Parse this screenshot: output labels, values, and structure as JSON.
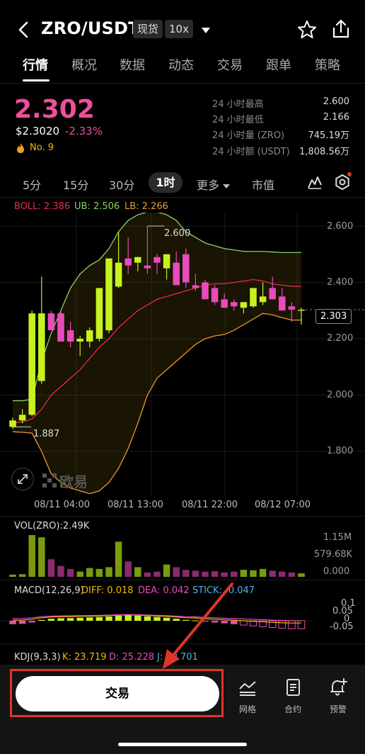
{
  "header": {
    "pair": "ZRO/USDT",
    "market_tag": "现货",
    "leverage_tag": "10x"
  },
  "tabs": [
    "行情",
    "概况",
    "数据",
    "动态",
    "交易",
    "跟单",
    "策略"
  ],
  "price": {
    "last": "2.302",
    "usd": "$2.3020",
    "change_pct": "-2.33%",
    "rank": "No. 9",
    "stats": [
      {
        "label": "24 小时最高",
        "value": "2.600"
      },
      {
        "label": "24 小时最低",
        "value": "2.166"
      },
      {
        "label": "24 小时量 (ZRO)",
        "value": "745.19万"
      },
      {
        "label": "24 小时额 (USDT)",
        "value": "1,808.56万"
      }
    ]
  },
  "timeframes": {
    "items": [
      "5分",
      "15分",
      "30分"
    ],
    "active": "1时",
    "more": "更多",
    "market_cap": "市值"
  },
  "boll": {
    "label": "BOLL: 2.386",
    "ub": "UB: 2.506",
    "lb": "LB: 2.266"
  },
  "price_axis": [
    "2.600",
    "2.400",
    "2.200",
    "2.000",
    "1.800"
  ],
  "current_price_tag": "2.303",
  "annot": {
    "high": "2.600",
    "low": "1.887"
  },
  "watermark": "欧易",
  "time_axis": [
    "08/11 04:00",
    "08/11 13:00",
    "08/11 22:00",
    "08/12 07:00"
  ],
  "volume": {
    "label": "VOL(ZRO):2.49K",
    "axis": [
      "1.15M",
      "579.68K",
      "0.000"
    ]
  },
  "macd": {
    "label": "MACD(12,26,9)",
    "diff": "DIFF: 0.018",
    "dea": "DEA: 0.042",
    "stick": "STICK: -0.047",
    "axis": [
      "0.1",
      "0.05",
      "0",
      "-0.05"
    ]
  },
  "kdj": {
    "label": "KDJ(9,3,3)",
    "k": "K: 23.719",
    "d": "D: 25.228",
    "j": "J: 20.701"
  },
  "bottom": {
    "trade": "交易",
    "grid": "网格",
    "contract": "合约",
    "alert": "预警"
  },
  "colors": {
    "up": "#c6f31f",
    "down": "#e94bbc",
    "boll_mid": "#e0304f",
    "boll_ub": "#8fd06a",
    "boll_lb": "#e89a2c",
    "accent": "#ee4f9c"
  },
  "chart_data": {
    "type": "candlestick",
    "x": [
      "08/11 01:00",
      "08/11 02:00",
      "08/11 03:00",
      "08/11 04:00",
      "08/11 05:00",
      "08/11 06:00",
      "08/11 07:00",
      "08/11 08:00",
      "08/11 09:00",
      "08/11 10:00",
      "08/11 11:00",
      "08/11 12:00",
      "08/11 13:00",
      "08/11 14:00",
      "08/11 15:00",
      "08/11 16:00",
      "08/11 17:00",
      "08/11 18:00",
      "08/11 19:00",
      "08/11 20:00",
      "08/11 21:00",
      "08/11 22:00",
      "08/11 23:00",
      "08/12 00:00",
      "08/12 01:00",
      "08/12 02:00",
      "08/12 03:00",
      "08/12 04:00",
      "08/12 05:00",
      "08/12 06:00",
      "08/12 07:00"
    ],
    "open": [
      1.887,
      1.91,
      1.93,
      2.05,
      2.29,
      2.29,
      2.23,
      2.19,
      2.19,
      2.2,
      2.23,
      2.385,
      2.485,
      2.47,
      2.46,
      2.49,
      2.45,
      2.47,
      2.5,
      2.39,
      2.4,
      2.38,
      2.34,
      2.33,
      2.31,
      2.315,
      2.33,
      2.38,
      2.35,
      2.315,
      2.303
    ],
    "high": [
      1.92,
      1.95,
      2.3,
      2.42,
      2.3,
      2.3,
      2.26,
      2.21,
      2.24,
      2.23,
      2.37,
      2.58,
      2.56,
      2.49,
      2.6,
      2.5,
      2.47,
      2.51,
      2.52,
      2.43,
      2.41,
      2.39,
      2.36,
      2.34,
      2.33,
      2.345,
      2.4,
      2.42,
      2.38,
      2.33,
      2.31
    ],
    "low": [
      1.88,
      1.9,
      1.925,
      2.04,
      2.24,
      2.22,
      2.17,
      2.14,
      2.17,
      2.19,
      2.22,
      2.38,
      2.43,
      2.44,
      2.43,
      2.43,
      2.41,
      2.46,
      2.38,
      2.37,
      2.37,
      2.32,
      2.31,
      2.3,
      2.29,
      2.31,
      2.32,
      2.34,
      2.3,
      2.26,
      2.25
    ],
    "close": [
      1.91,
      1.93,
      2.29,
      2.29,
      2.23,
      2.19,
      2.19,
      2.2,
      2.23,
      2.38,
      2.485,
      2.47,
      2.46,
      2.49,
      2.45,
      2.47,
      2.5,
      2.39,
      2.4,
      2.38,
      2.34,
      2.33,
      2.31,
      2.315,
      2.33,
      2.38,
      2.35,
      2.34,
      2.3,
      2.303,
      2.303
    ],
    "boll_mid": [
      1.9,
      1.905,
      1.915,
      1.95,
      2.0,
      2.03,
      2.06,
      2.09,
      2.13,
      2.17,
      2.2,
      2.24,
      2.27,
      2.3,
      2.32,
      2.34,
      2.35,
      2.36,
      2.37,
      2.38,
      2.39,
      2.395,
      2.395,
      2.4,
      2.405,
      2.41,
      2.405,
      2.395,
      2.39,
      2.386,
      2.386
    ],
    "boll_ub": [
      1.98,
      1.98,
      1.985,
      2.12,
      2.22,
      2.3,
      2.38,
      2.43,
      2.46,
      2.48,
      2.52,
      2.58,
      2.62,
      2.64,
      2.65,
      2.65,
      2.64,
      2.62,
      2.58,
      2.56,
      2.54,
      2.53,
      2.52,
      2.515,
      2.51,
      2.51,
      2.51,
      2.508,
      2.506,
      2.506,
      2.506
    ],
    "boll_lb": [
      1.87,
      1.868,
      1.865,
      1.8,
      1.72,
      1.69,
      1.67,
      1.66,
      1.65,
      1.66,
      1.69,
      1.74,
      1.81,
      1.9,
      2.0,
      2.06,
      2.09,
      2.12,
      2.15,
      2.18,
      2.2,
      2.21,
      2.215,
      2.23,
      2.25,
      2.27,
      2.29,
      2.285,
      2.275,
      2.266,
      2.266
    ],
    "volume": [
      0.05,
      0.06,
      0.95,
      0.9,
      0.4,
      0.25,
      0.18,
      0.12,
      0.2,
      0.18,
      0.22,
      0.8,
      0.35,
      0.22,
      0.1,
      0.12,
      0.28,
      0.22,
      0.16,
      0.14,
      0.12,
      0.13,
      0.1,
      0.12,
      0.16,
      0.15,
      0.18,
      0.14,
      0.12,
      0.1,
      0.08
    ],
    "macd_stick": [
      -0.02,
      -0.018,
      -0.01,
      0.005,
      0.012,
      0.015,
      0.016,
      0.018,
      0.02,
      0.022,
      0.025,
      0.03,
      0.032,
      0.03,
      0.026,
      0.022,
      0.018,
      0.012,
      0.005,
      0.002,
      -0.005,
      -0.01,
      -0.015,
      -0.02,
      -0.025,
      -0.03,
      -0.035,
      -0.04,
      -0.044,
      -0.047,
      -0.047
    ],
    "ylim": [
      1.75,
      2.7
    ],
    "title": "",
    "xlabel": "",
    "ylabel": ""
  }
}
